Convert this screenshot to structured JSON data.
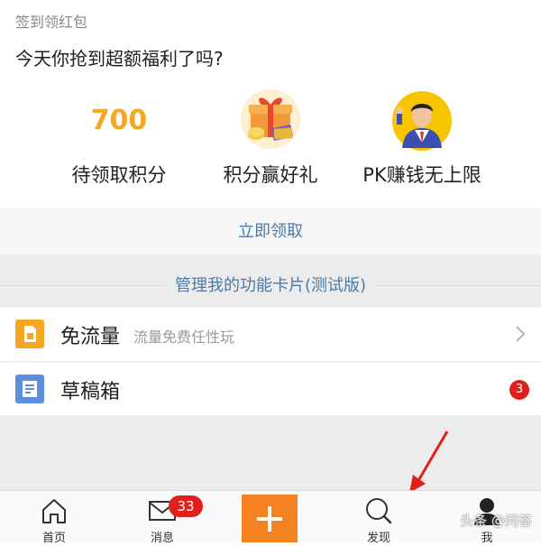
{
  "section": {
    "label": "签到领红包"
  },
  "promo": {
    "title": "今天你抢到超额福利了吗?"
  },
  "rewards": [
    {
      "value": "700",
      "caption": "待领取积分"
    },
    {
      "caption": "积分赢好礼",
      "icon": "gift-box-icon"
    },
    {
      "caption": "PK赚钱无上限",
      "icon": "host-avatar"
    }
  ],
  "claim": {
    "label": "立即领取"
  },
  "manage": {
    "label": "管理我的功能卡片(测试版)"
  },
  "cards": [
    {
      "name": "免流量",
      "desc": "流量免费任性玩",
      "icon": "sim-card-icon",
      "color": "#f5a623"
    },
    {
      "name": "草稿箱",
      "badge": "3",
      "icon": "draft-icon",
      "color": "#5b8fe0"
    }
  ],
  "nav": {
    "home": "首页",
    "messages": "消息",
    "messages_badge": "33",
    "discover": "发现",
    "me": "我"
  },
  "watermark": "头条 @问答",
  "colors": {
    "accent": "#f58220",
    "link": "#4c7aa8",
    "badge": "#e0201b",
    "points": "#f5a623"
  }
}
